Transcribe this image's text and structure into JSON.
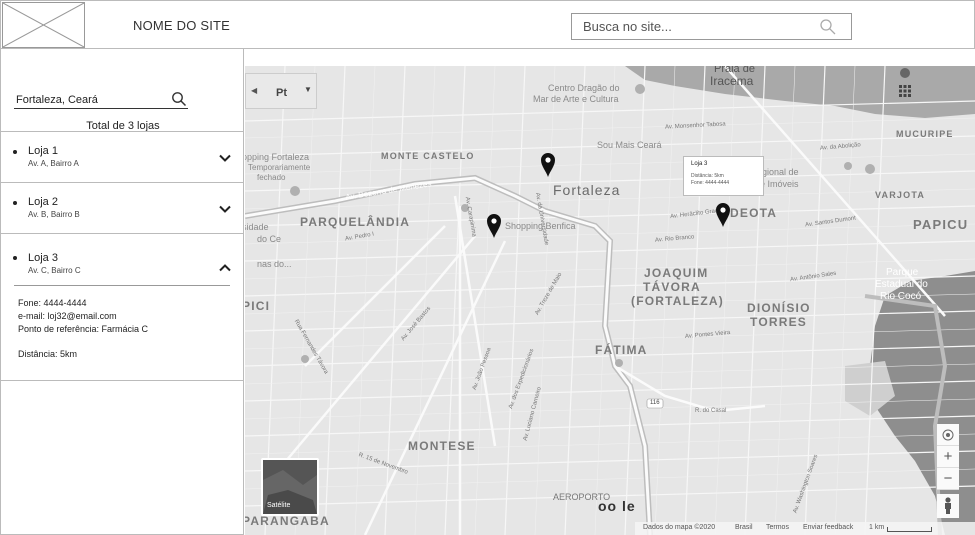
{
  "header": {
    "site_name": "NOME DO SITE",
    "search_placeholder": "Busca no site..."
  },
  "sidebar": {
    "location_value": "Fortaleza, Ceará",
    "total_label": "Total de 3 lojas",
    "stores": [
      {
        "name": "Loja 1",
        "address": "Av. A, Bairro A",
        "expanded": false
      },
      {
        "name": "Loja 2",
        "address": "Av. B, Bairro B",
        "expanded": false
      },
      {
        "name": "Loja 3",
        "address": "Av. C, Bairro C",
        "expanded": true,
        "phone": "Fone: 4444-4444",
        "email": "e-mail: loj32@email.com",
        "reference": "Ponto de referência: Farmácia C",
        "distance": "Distância: 5km"
      }
    ]
  },
  "map": {
    "mode_label": "Pt",
    "tooltip": {
      "title": "Loja 3",
      "distance": "Distância: 5km",
      "phone": "Fone: 4444-4444"
    },
    "labels": {
      "praia": "Praia de",
      "iracema": "Iracema",
      "centro_dragao_1": "Centro Dragão do",
      "centro_dragao_2": "Mar de Arte e Cultura",
      "monte_castelo": "MONTE CASTELO",
      "fortaleza": "Fortaleza",
      "sou_mais": "Sou Mais Ceará",
      "mucuripe": "MUCURIPE",
      "parquelandia": "PARQUELÂNDIA",
      "shopping_fortaleza": "opping Fortaleza",
      "temporariamente": "Temporariamente",
      "fechado": "fechado",
      "shopping_benfica": "Shopping Benfica",
      "aldeota": "DEOTA",
      "varjota": "VARJOTA",
      "papicu": "PAPICU",
      "joaquim": "JOAQUIM",
      "tavora": "TÁVORA",
      "fortaleza_paren": "(FORTALEZA)",
      "dionisio": "DIONÍSIO",
      "torres": "TORRES",
      "parque_1": "Parque",
      "parque_2": "Estadual do",
      "parque_3": "Rio Cocó",
      "fatima": "FÁTIMA",
      "pici": "PICI",
      "montese": "MONTESE",
      "aeroporto": "AEROPORTO",
      "parangaba": "PARANGABA",
      "regional": "gional de",
      "imoveis": "de Imóveis",
      "sidade": "sidade",
      "do_ce": "do Ce",
      "nas_do": "nas do...",
      "br116": "116",
      "bezerra": "Av. Bezerra de Menezes",
      "monsenhor": "Av. Monsenhor Tabosa",
      "abolicao": "Av. da Abolição",
      "santos_dumont": "Av. Santos Dumont",
      "heraclito": "Av. Heráclito Graça",
      "antonio_sales": "Av. Antônio Sales",
      "pontes_vieira": "Av. Pontes Vieira",
      "treze_maio": "Av. Treze de Maio",
      "expedicionarios": "Av. dos Expedicionários",
      "joao_pessoa": "Av. João Pessoa",
      "jose_bastos": "Av. José Bastos",
      "fernandes_tavora": "Rua Fernandes Távora",
      "quinze_novembro": "R. 15 de Novembro",
      "do_casal": "R. do Casal",
      "universidade": "Av. da Universidade",
      "carapinima": "Av. Carapinima",
      "rio_branco": "Av. Rio Branco",
      "luciano": "Av. Luciano Carneiro",
      "pedro_1": "Av. Pedro I",
      "washington": "Av. Washington Soares"
    },
    "satellite_label": "Satélite",
    "google": "oo le",
    "footer": {
      "data": "Dados do mapa ©2020",
      "country": "Brasil",
      "terms": "Termos",
      "feedback": "Enviar feedback",
      "scale": "1 km"
    }
  }
}
